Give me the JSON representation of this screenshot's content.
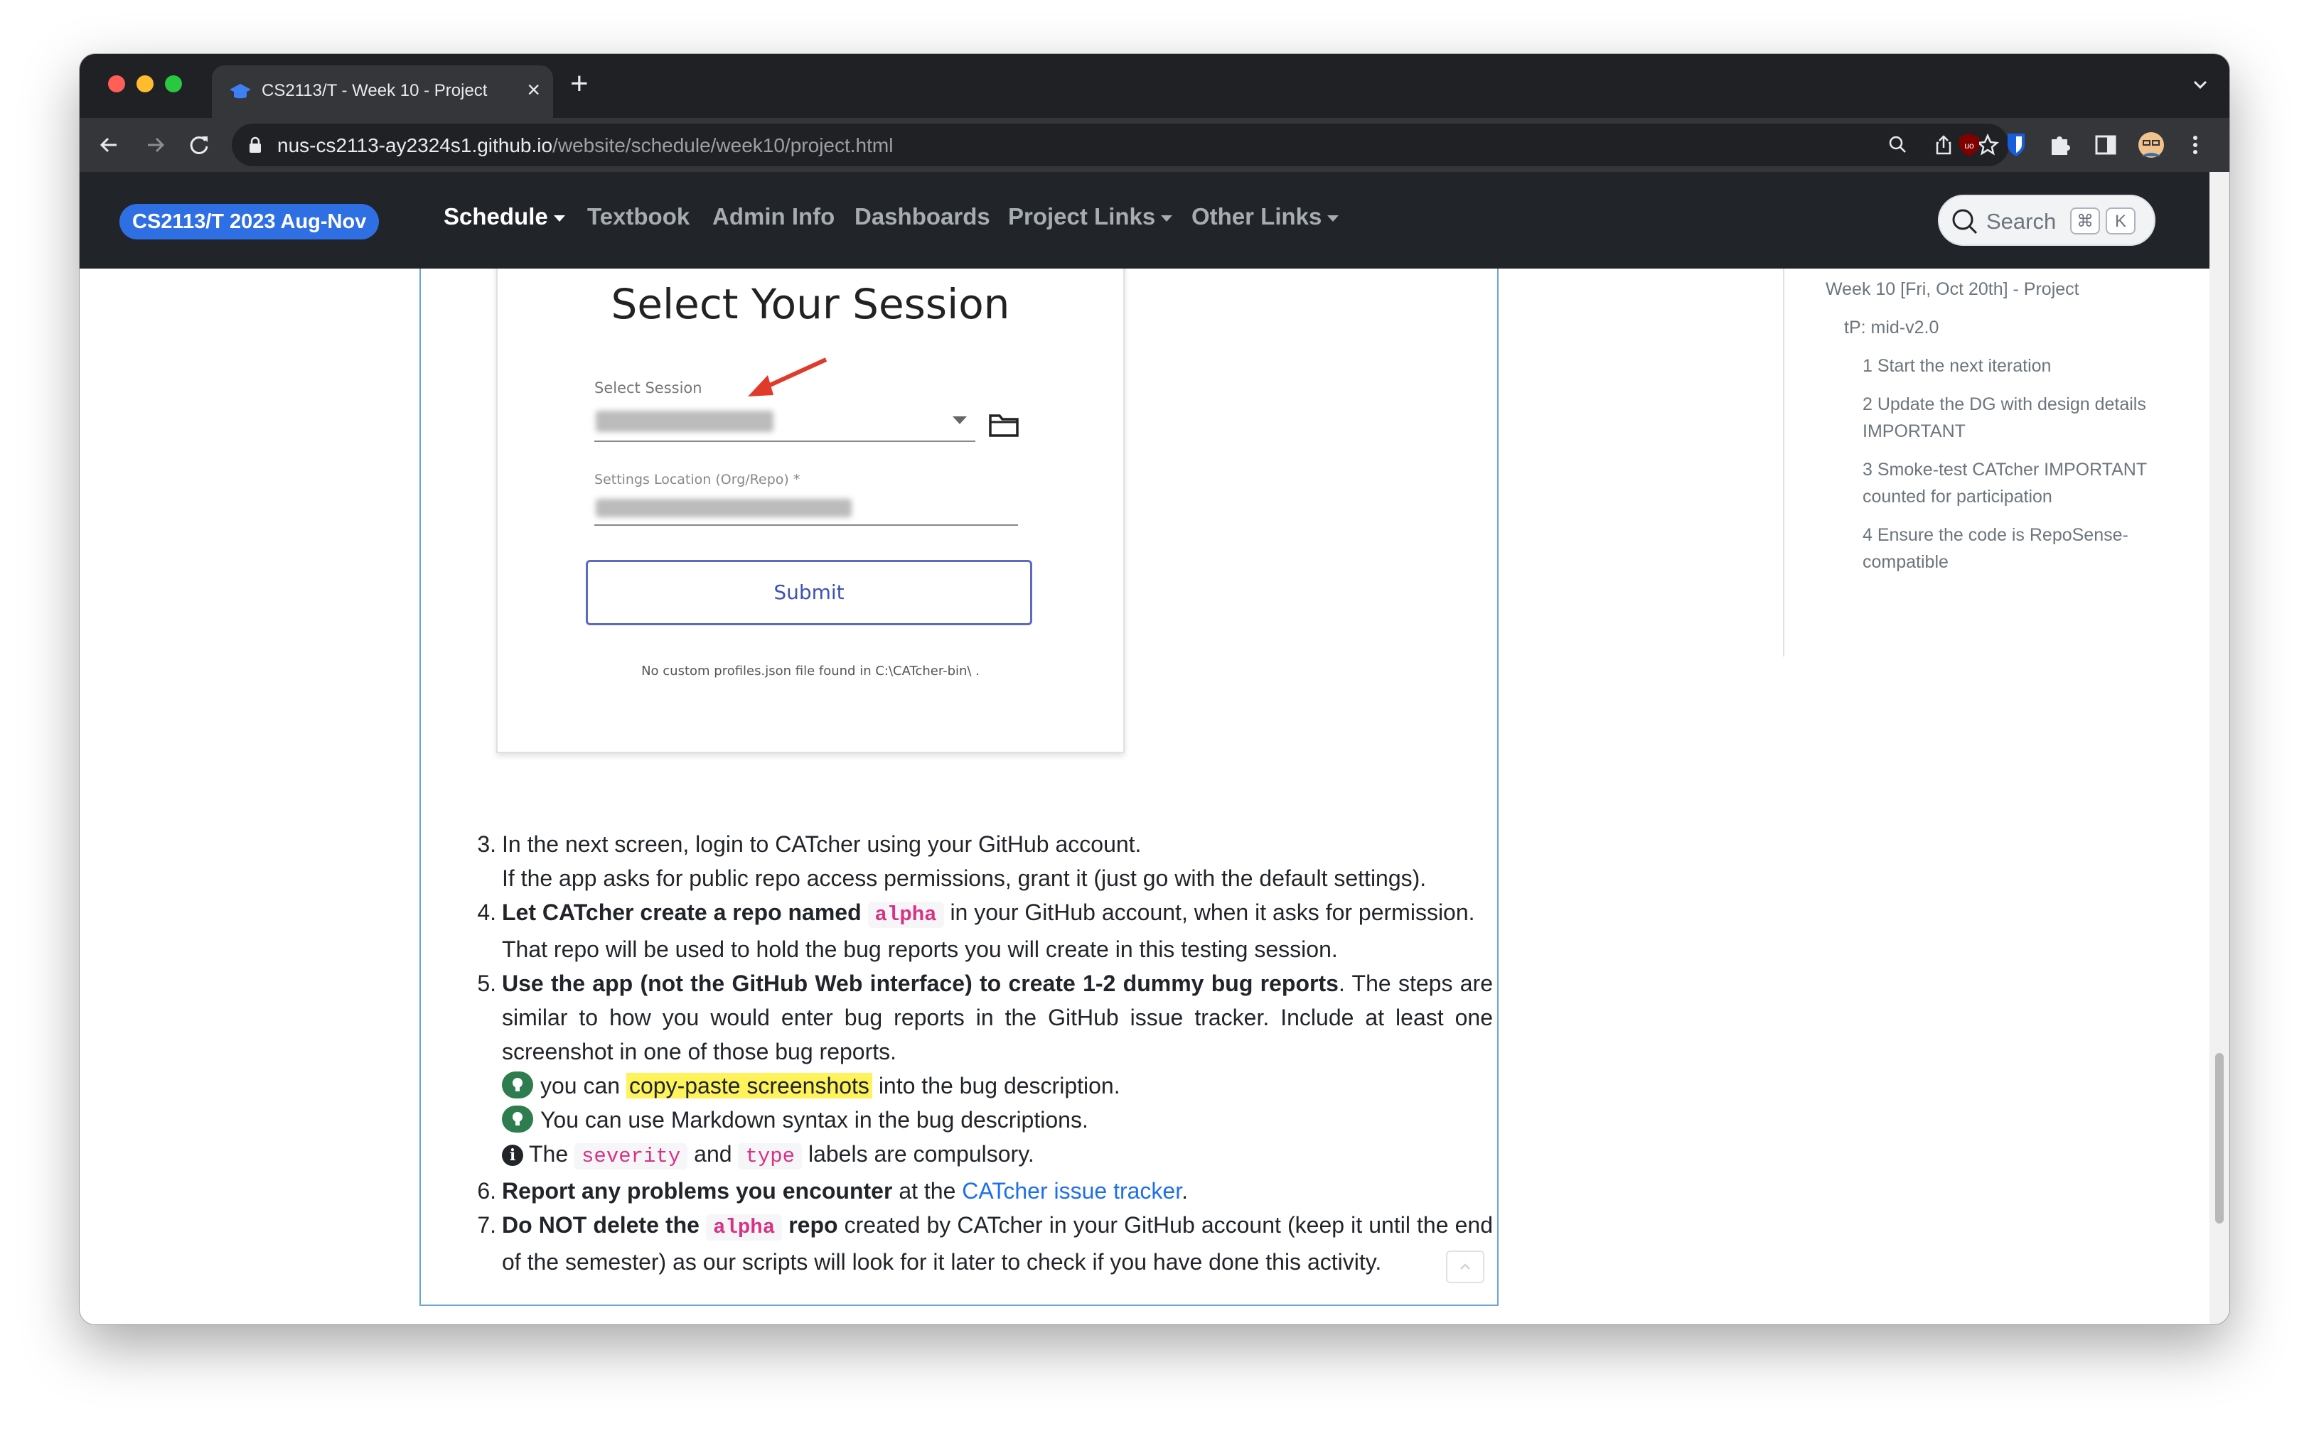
{
  "browser": {
    "tab_title": "CS2113/T - Week 10 - Project",
    "tab_close": "×",
    "new_tab": "+",
    "url_domain": "nus-cs2113-ay2324s1.github.io",
    "url_path": "/website/schedule/week10/project.html"
  },
  "navbar": {
    "brand": "CS2113/T 2023 Aug-Nov",
    "items": [
      {
        "label": "Schedule",
        "dropdown": true,
        "active": true
      },
      {
        "label": "Textbook",
        "dropdown": false
      },
      {
        "label": "Admin Info",
        "dropdown": false
      },
      {
        "label": "Dashboards",
        "dropdown": false
      },
      {
        "label": "Project Links",
        "dropdown": true
      },
      {
        "label": "Other Links",
        "dropdown": true
      }
    ],
    "search_placeholder": "Search",
    "search_key1": "⌘",
    "search_key2": "K"
  },
  "screenshot": {
    "title": "Select Your Session",
    "session_label": "Select Session",
    "settings_label": "Settings Location (Org/Repo) *",
    "submit": "Submit",
    "note": "No custom profiles.json file found in C:\\CATcher-bin\\ ."
  },
  "steps": {
    "s3_num": "3.",
    "s3_text": "In the next screen, login to CATcher using your GitHub account.",
    "s3_text2": "If the app asks for public repo access permissions, grant it (just go with the default settings).",
    "s4_num": "4.",
    "s4_bold": "Let CATcher create a repo named",
    "s4_code": "alpha",
    "s4_rest": " in your GitHub account, when it asks for permission.",
    "s4_text2": "That repo will be used to hold the bug reports you will create in this testing session.",
    "s5_num": "5.",
    "s5_bold": "Use the app (not the GitHub Web interface) to create 1-2 dummy bug reports",
    "s5_rest": ". The steps are similar to how you would enter bug reports in the GitHub issue tracker. Include at least one screenshot in one of those bug reports.",
    "tip1_pre": "you can ",
    "tip1_hl": "copy-paste screenshots",
    "tip1_post": " into the bug description.",
    "tip2": "You can use Markdown syntax in the bug descriptions.",
    "info_pre": "The ",
    "info_code1": "severity",
    "info_mid": " and ",
    "info_code2": "type",
    "info_post": " labels are compulsory.",
    "s6_num": "6.",
    "s6_bold": "Report any problems you encounter",
    "s6_mid": " at the ",
    "s6_link": "CATcher issue tracker",
    "s6_end": ".",
    "s7_num": "7.",
    "s7_bold1": "Do NOT delete the ",
    "s7_code": "alpha",
    "s7_bold2": " repo",
    "s7_rest": " created by CATcher in your GitHub account (keep it until the end of the semester) as our scripts will look for it later to check if you have done this activity."
  },
  "toc": [
    "Week 10 [Fri, Oct 20th] - Project",
    "tP: mid-v2.0",
    "1 Start the next iteration",
    "2 Update the DG with design details",
    "IMPORTANT",
    "3 Smoke-test CATcher IMPORTANT",
    "counted for participation",
    "4 Ensure the code is RepoSense-",
    "compatible"
  ]
}
